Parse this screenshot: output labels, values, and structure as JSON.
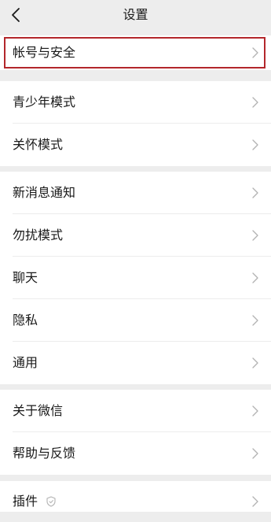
{
  "header": {
    "title": "设置",
    "back_icon": "chevron-left-icon"
  },
  "groups": [
    {
      "items": [
        {
          "label": "帐号与安全",
          "highlighted": true
        }
      ]
    },
    {
      "items": [
        {
          "label": "青少年模式"
        },
        {
          "label": "关怀模式"
        }
      ]
    },
    {
      "items": [
        {
          "label": "新消息通知"
        },
        {
          "label": "勿扰模式"
        },
        {
          "label": "聊天"
        },
        {
          "label": "隐私"
        },
        {
          "label": "通用"
        }
      ]
    },
    {
      "items": [
        {
          "label": "关于微信"
        },
        {
          "label": "帮助与反馈"
        }
      ]
    },
    {
      "items": [
        {
          "label": "插件",
          "badge_icon": "shield-icon"
        }
      ]
    }
  ],
  "colors": {
    "background": "#ededed",
    "row_background": "#ffffff",
    "text": "#191919",
    "chevron": "#b2b2b2",
    "highlight_border": "#b3272b"
  }
}
